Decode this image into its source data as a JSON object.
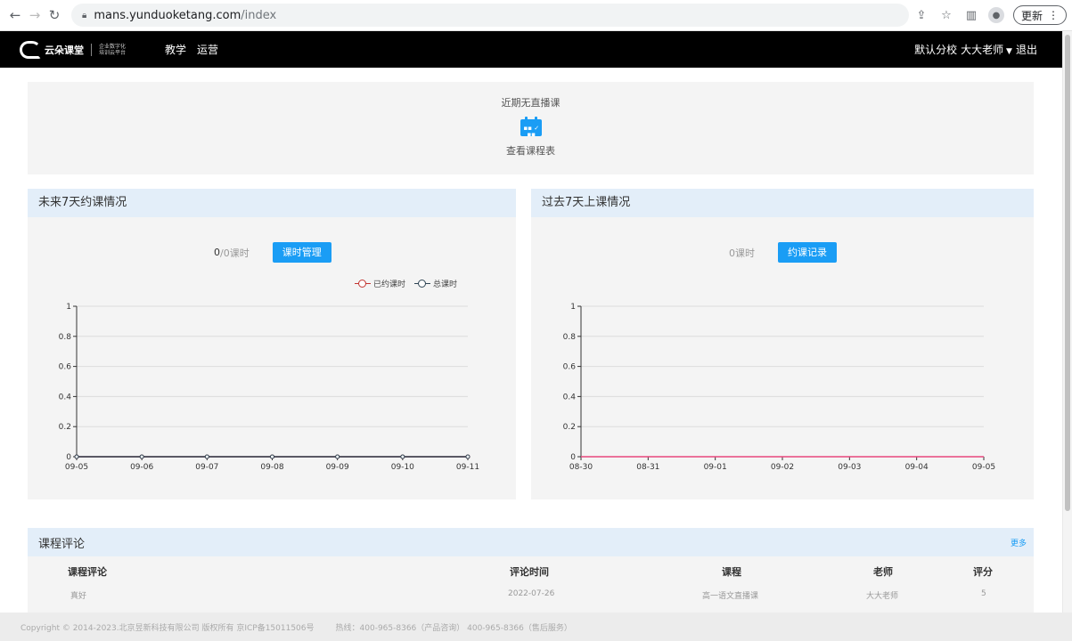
{
  "browser": {
    "url_host": "mans.yunduoketang.com",
    "url_path": "/index",
    "update_label": "更新"
  },
  "header": {
    "logo_text": "云朵课堂",
    "logo_slogan_line1": "企业数字化",
    "logo_slogan_line2": "培训云平台",
    "nav": [
      "教学",
      "运营"
    ],
    "branch": "默认分校",
    "user": "大大老师",
    "logout": "退出"
  },
  "live": {
    "title": "近期无直播课",
    "link_label": "查看课程表",
    "icon": "calendar-icon"
  },
  "future_card": {
    "title": "未来7天约课情况",
    "booked_value": "0",
    "total_suffix": "/0课时",
    "button_label": "课时管理",
    "legend": [
      "已约课时",
      "总课时"
    ]
  },
  "past_card": {
    "title": "过去7天上课情况",
    "hours_label": "0课时",
    "button_label": "约课记录"
  },
  "chart_data": [
    {
      "type": "line",
      "x": [
        "09-05",
        "09-06",
        "09-07",
        "09-08",
        "09-09",
        "09-10",
        "09-11"
      ],
      "series": [
        {
          "name": "已约课时",
          "values": [
            0,
            0,
            0,
            0,
            0,
            0,
            0
          ],
          "color": "#c23531"
        },
        {
          "name": "总课时",
          "values": [
            0,
            0,
            0,
            0,
            0,
            0,
            0
          ],
          "color": "#2f4554"
        }
      ],
      "ylim": [
        0,
        1
      ],
      "yticks": [
        "0",
        "0.2",
        "0.4",
        "0.6",
        "0.8",
        "1"
      ],
      "grid": true,
      "legend": "top-right"
    },
    {
      "type": "line",
      "x": [
        "08-30",
        "08-31",
        "09-01",
        "09-02",
        "09-03",
        "09-04",
        "09-05"
      ],
      "series": [
        {
          "values": [
            0,
            0,
            0,
            0,
            0,
            0,
            0
          ],
          "color": "#e8467c"
        }
      ],
      "ylim": [
        0,
        1
      ],
      "yticks": [
        "0",
        "0.2",
        "0.4",
        "0.6",
        "0.8",
        "1"
      ],
      "grid": true
    }
  ],
  "reviews": {
    "title": "课程评论",
    "more_label": "更多",
    "columns": [
      "课程评论",
      "评论时间",
      "课程",
      "老师",
      "评分"
    ],
    "rows": [
      [
        "真好",
        "2022-07-26",
        "高一语文直播课",
        "大大老师",
        "5"
      ]
    ]
  },
  "footer": {
    "copyright": "Copyright © 2014-2023.北京昱新科技有限公司 版权所有 京ICP备15011506号",
    "hotline": "热线：400-965-8366（产品咨询） 400-965-8366（售后服务）"
  }
}
